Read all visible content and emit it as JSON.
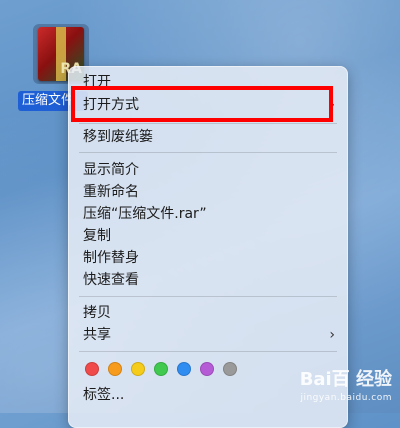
{
  "file": {
    "name": "压缩文件",
    "icon_label": "RA"
  },
  "menu": {
    "open": "打开",
    "open_with": "打开方式",
    "trash": "移到废纸篓",
    "get_info": "显示简介",
    "rename": "重新命名",
    "compress": "压缩“压缩文件.rar”",
    "duplicate": "复制",
    "make_alias": "制作替身",
    "quick_look": "快速查看",
    "copy": "拷贝",
    "share": "共享",
    "tags": "标签..."
  },
  "tag_colors": [
    "#f04a4a",
    "#f79b1c",
    "#f5cc1a",
    "#3fc94f",
    "#2f8cf1",
    "#b55bd6",
    "#9a9a9a"
  ],
  "watermark": {
    "main": "Bai百 经验",
    "sub": "jingyan.baidu.com"
  }
}
